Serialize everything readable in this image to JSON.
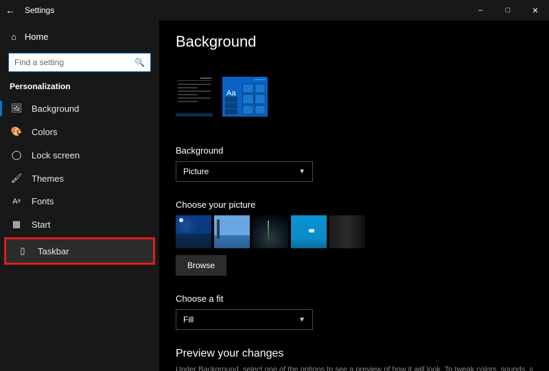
{
  "window": {
    "title": "Settings"
  },
  "sidebar": {
    "home": "Home",
    "search_placeholder": "Find a setting",
    "section": "Personalization",
    "items": [
      {
        "label": "Background",
        "selected": true
      },
      {
        "label": "Colors"
      },
      {
        "label": "Lock screen"
      },
      {
        "label": "Themes"
      },
      {
        "label": "Fonts"
      },
      {
        "label": "Start"
      },
      {
        "label": "Taskbar",
        "highlighted": true
      }
    ]
  },
  "main": {
    "title": "Background",
    "preview_aa": "Aa",
    "background_label": "Background",
    "background_value": "Picture",
    "choose_picture_label": "Choose your picture",
    "browse_label": "Browse",
    "choose_fit_label": "Choose a fit",
    "fit_value": "Fill",
    "preview_changes_title": "Preview your changes",
    "preview_changes_cutoff": "Under Background, select one of the options to see a preview of how it will look. To tweak colors, sounds, and"
  }
}
